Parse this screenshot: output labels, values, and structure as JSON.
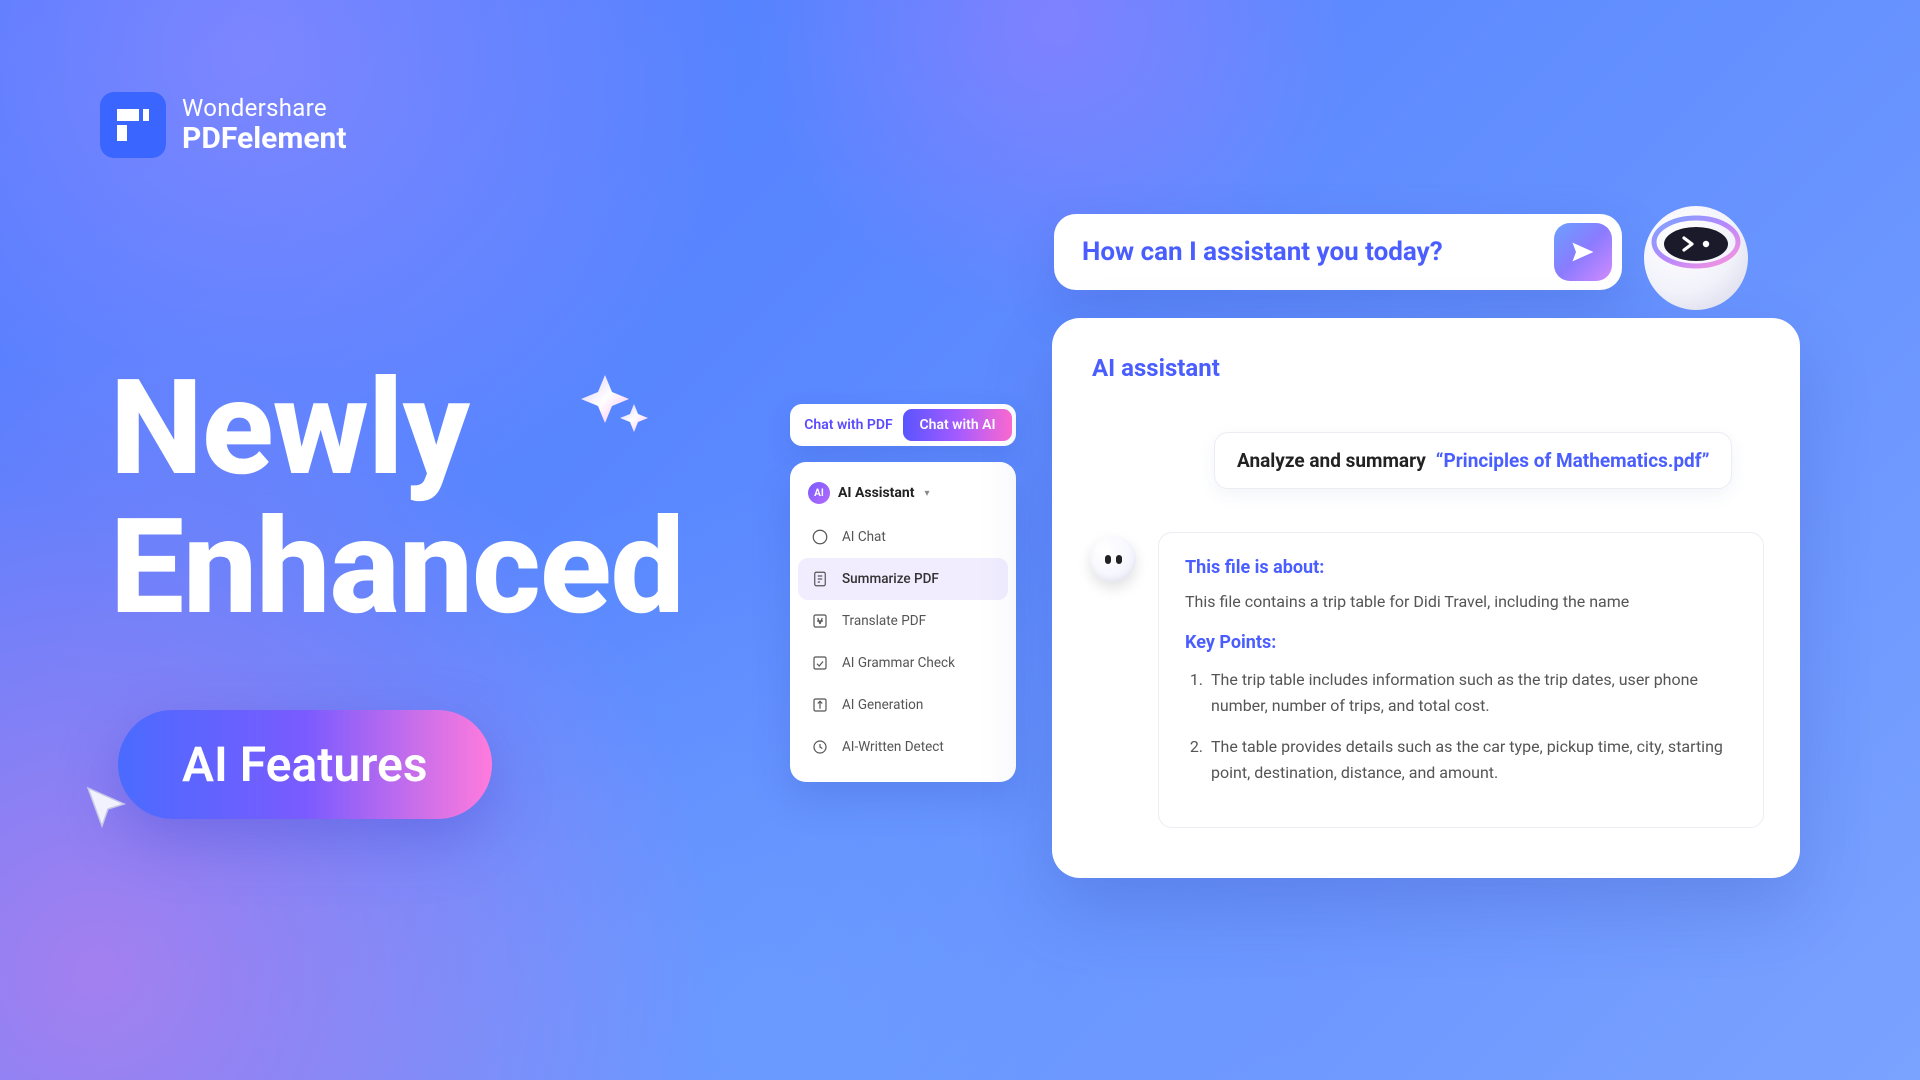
{
  "brand": {
    "top": "Wondershare",
    "name": "PDFelement"
  },
  "hero": {
    "line1": "Newly",
    "line2": "Enhanced",
    "pill": "AI Features"
  },
  "tabs": {
    "pdf": "Chat with PDF",
    "ai": "Chat with AI"
  },
  "menu": {
    "head_badge": "AI",
    "head_title": "AI Assistant",
    "items": [
      {
        "label": "AI Chat"
      },
      {
        "label": "Summarize PDF"
      },
      {
        "label": "Translate PDF"
      },
      {
        "label": "AI Grammar Check"
      },
      {
        "label": "AI Generation"
      },
      {
        "label": "AI-Written Detect"
      }
    ],
    "selected_index": 1
  },
  "askbar": {
    "prompt": "How can I assistant you today?"
  },
  "assistant": {
    "title": "AI assistant",
    "chip_a": "Analyze and summary",
    "chip_b": "“Principles of Mathematics.pdf”",
    "about_heading": "This file is about:",
    "about_body": "This file contains a trip table for Didi Travel, including the name",
    "keypoints_heading": "Key Points:",
    "keypoints": [
      "The trip table includes information such as the trip dates, user phone number, number of trips, and total cost.",
      "The table provides details such as the car type, pickup time, city, starting point, destination, distance, and amount."
    ]
  }
}
